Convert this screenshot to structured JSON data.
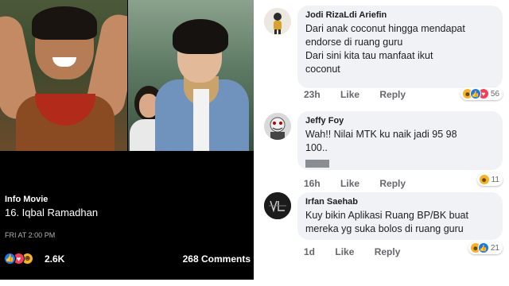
{
  "post": {
    "title": "Info Movie",
    "subtitle": "16. Iqbal Ramadhan",
    "time": "FRI AT 2:00 PM",
    "reaction_count": "2.6K",
    "comment_count": "268 Comments",
    "reactions": [
      "like-icon",
      "love-icon",
      "haha-icon"
    ]
  },
  "comments": [
    {
      "name": "Jodi RizaLdi Ariefin",
      "lines": [
        "Dari anak coconut hingga mendapat",
        "endorse di ruang guru",
        "Dari sini kita tau manfaat ikut",
        "coconut"
      ],
      "time": "23h",
      "like": "Like",
      "reply": "Reply",
      "reactions": [
        "haha-icon",
        "like-icon",
        "love-icon"
      ],
      "reaction_count": "56"
    },
    {
      "name": "Jeffy Foy",
      "lines": [
        "Wah!! Nilai MTK ku naik jadi 95 98",
        "100.."
      ],
      "time": "16h",
      "like": "Like",
      "reply": "Reply",
      "reactions": [
        "haha-icon"
      ],
      "reaction_count": "11"
    },
    {
      "name": "Irfan Saehab",
      "lines": [
        "Kuy bikin Aplikasi Ruang BP/BK buat",
        "mereka yg suka bolos di ruang guru"
      ],
      "time": "1d",
      "like": "Like",
      "reply": "Reply",
      "reactions": [
        "haha-icon",
        "like-icon"
      ],
      "reaction_count": "21"
    }
  ],
  "colors": {
    "like": "#1877f2",
    "love": "#f33e58",
    "haha": "#f7b125",
    "bubble": "#f0f2f5",
    "muted": "#65676b"
  }
}
